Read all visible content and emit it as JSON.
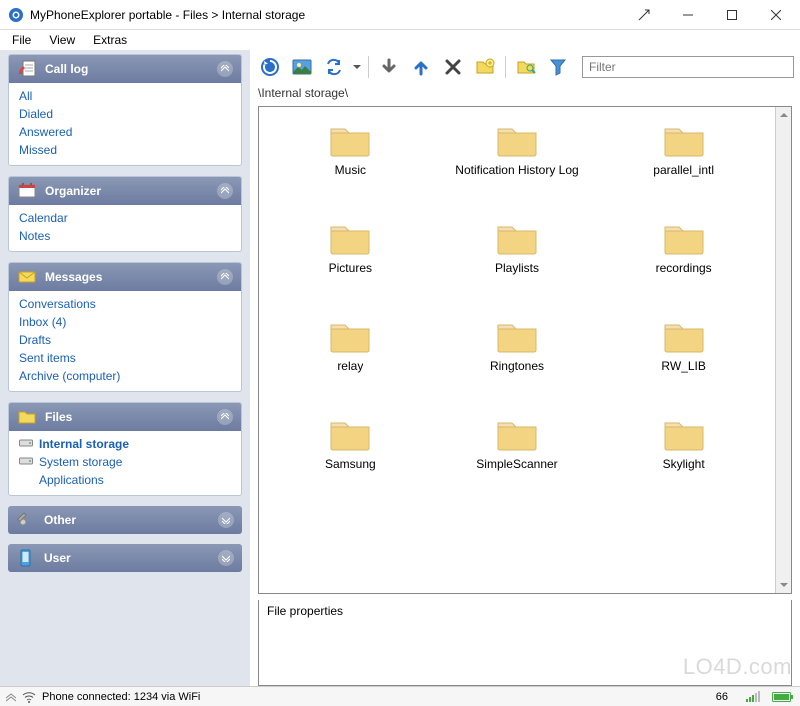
{
  "window": {
    "title": "MyPhoneExplorer portable - Files > Internal storage"
  },
  "menubar": {
    "file": "File",
    "view": "View",
    "extras": "Extras"
  },
  "sidebar": {
    "call_log": {
      "title": "Call log",
      "items": [
        "All",
        "Dialed",
        "Answered",
        "Missed"
      ]
    },
    "organizer": {
      "title": "Organizer",
      "items": [
        "Calendar",
        "Notes"
      ]
    },
    "messages": {
      "title": "Messages",
      "items": [
        "Conversations",
        "Inbox (4)",
        "Drafts",
        "Sent items",
        "Archive (computer)"
      ]
    },
    "files": {
      "title": "Files",
      "items": [
        "Internal storage",
        "System storage",
        "Applications"
      ],
      "active": 0
    },
    "other": {
      "title": "Other"
    },
    "user": {
      "title": "User"
    }
  },
  "toolbar": {
    "filter_placeholder": "Filter"
  },
  "path": "\\Internal storage\\",
  "folders": [
    "Music",
    "Notification History Log",
    "parallel_intl",
    "Pictures",
    "Playlists",
    "recordings",
    "relay",
    "Ringtones",
    "RW_LIB",
    "Samsung",
    "SimpleScanner",
    "Skylight"
  ],
  "properties": {
    "label": "File properties"
  },
  "statusbar": {
    "text": "Phone connected: 1234 via WiFi",
    "num": "66"
  },
  "watermark": "LO4D.com"
}
